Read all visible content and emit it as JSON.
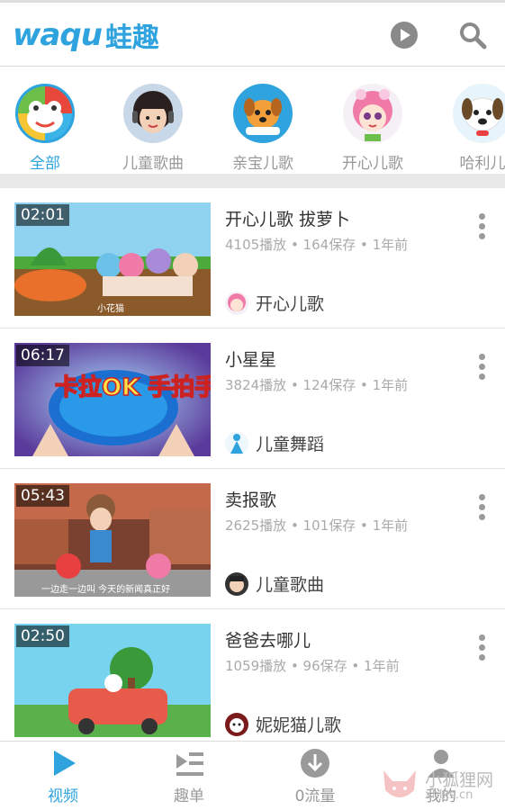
{
  "header": {
    "logo_latin": "waqu",
    "logo_cjk": "蛙趣",
    "brand_color": "#2fa3de"
  },
  "categories": [
    {
      "label": "全部",
      "active": true
    },
    {
      "label": "儿童歌曲",
      "active": false
    },
    {
      "label": "亲宝儿歌",
      "active": false
    },
    {
      "label": "开心儿歌",
      "active": false
    },
    {
      "label": "哈利儿",
      "active": false
    }
  ],
  "videos": [
    {
      "duration": "02:01",
      "title": "开心儿歌 拔萝卜",
      "meta": "4105播放 • 164保存 • 1年前",
      "channel": "开心儿歌",
      "caption": "小花猫"
    },
    {
      "duration": "06:17",
      "title": "小星星",
      "meta": "3824播放 • 124保存 • 1年前",
      "channel": "儿童舞蹈",
      "caption": "卡拉OK 手拍手"
    },
    {
      "duration": "05:43",
      "title": "卖报歌",
      "meta": "2625播放 • 101保存 • 1年前",
      "channel": "儿童歌曲",
      "caption": "一边走一边叫 今天的新闻真正好"
    },
    {
      "duration": "02:50",
      "title": "爸爸去哪儿",
      "meta": "1059播放 • 96保存 • 1年前",
      "channel": "妮妮猫儿歌",
      "caption": ""
    }
  ],
  "bottom_nav": [
    {
      "label": "视频",
      "icon": "play-icon",
      "active": true
    },
    {
      "label": "趣单",
      "icon": "playlist-icon",
      "active": false
    },
    {
      "label": "0流量",
      "icon": "download-icon",
      "active": false
    },
    {
      "label": "我的",
      "icon": "user-icon",
      "active": false
    }
  ],
  "watermark": {
    "text": "小狐狸网",
    "url": "xhlks.cn"
  }
}
